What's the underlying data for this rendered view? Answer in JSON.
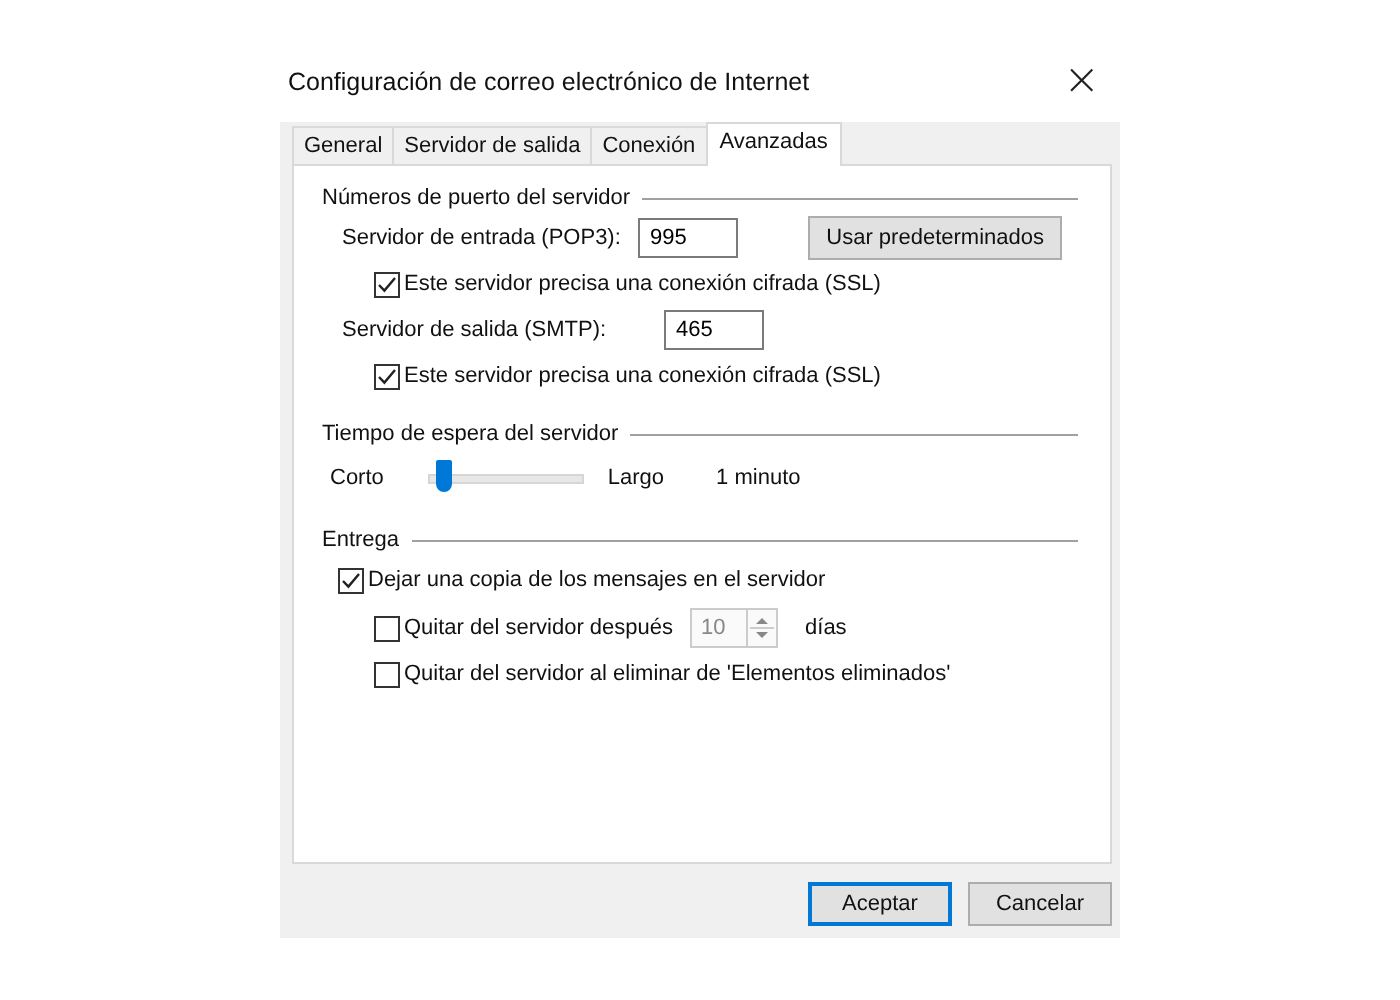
{
  "window": {
    "title": "Configuración de correo electrónico de Internet",
    "close": "×"
  },
  "tabs": [
    {
      "label": "General",
      "selected": false
    },
    {
      "label": "Servidor de salida",
      "selected": false
    },
    {
      "label": "Conexión",
      "selected": false
    },
    {
      "label": "Avanzadas",
      "selected": true
    }
  ],
  "ports": {
    "heading": "Números de puerto del servidor",
    "incoming_label": "Servidor de entrada (POP3):",
    "incoming_value": "995",
    "incoming_ssl": {
      "label": "Este servidor precisa una conexión cifrada (SSL)",
      "checked": true
    },
    "defaults_button": "Usar predeterminados",
    "outgoing_label": "Servidor de salida (SMTP):",
    "outgoing_value": "465",
    "outgoing_ssl": {
      "label": "Este servidor precisa una conexión cifrada (SSL)",
      "checked": true
    }
  },
  "timeout": {
    "heading": "Tiempo de espera del servidor",
    "min_label": "Corto",
    "max_label": "Largo",
    "level": 0.1,
    "reading": "1 minuto"
  },
  "delivery": {
    "heading": "Entrega",
    "leave_copy": {
      "label": "Dejar una copia de los mensajes en el servidor",
      "checked": true
    },
    "remove_after": {
      "label": "Quitar del servidor después",
      "checked": false
    },
    "days_value": "10",
    "days_disabled": true,
    "days_unit": "días",
    "remove_deleted": {
      "label": "Quitar del servidor al eliminar de 'Elementos eliminados'",
      "checked": false
    }
  },
  "buttons": [
    {
      "label": "Aceptar",
      "default": true
    },
    {
      "label": "Cancelar",
      "default": false
    }
  ]
}
